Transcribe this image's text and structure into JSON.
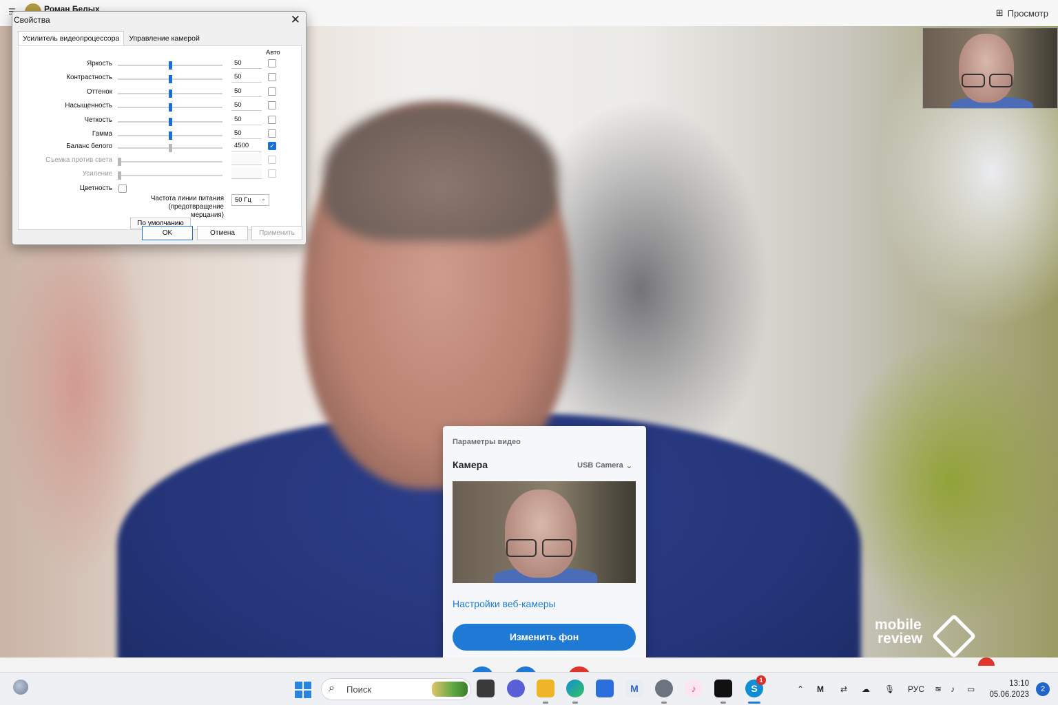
{
  "topbar": {
    "caller_name": "Роман Белых",
    "view_label": "Просмотр"
  },
  "dialog": {
    "title": "Свойства",
    "tabs": [
      "Усилитель видеопроцессора",
      "Управление камерой"
    ],
    "auto_label": "Авто",
    "properties": [
      {
        "label": "Яркость",
        "value": "50",
        "level": 0.5,
        "auto": false,
        "enabled": true
      },
      {
        "label": "Контрастность",
        "value": "50",
        "level": 0.5,
        "auto": false,
        "enabled": true
      },
      {
        "label": "Оттенок",
        "value": "50",
        "level": 0.5,
        "auto": false,
        "enabled": true
      },
      {
        "label": "Насыщенность",
        "value": "50",
        "level": 0.5,
        "auto": false,
        "enabled": true
      },
      {
        "label": "Четкость",
        "value": "50",
        "level": 0.5,
        "auto": false,
        "enabled": true
      },
      {
        "label": "Гамма",
        "value": "50",
        "level": 0.5,
        "auto": false,
        "enabled": true
      },
      {
        "label": "Баланс белого",
        "value": "4500",
        "level": 0.5,
        "auto": true,
        "enabled": true
      },
      {
        "label": "Съемка против света",
        "value": "",
        "level": 0.0,
        "auto": false,
        "enabled": false
      },
      {
        "label": "Усиление",
        "value": "",
        "level": 0.0,
        "auto": false,
        "enabled": false
      }
    ],
    "color_label": "Цветность",
    "power_line_label": "Частота линии питания (предотвращение мерцания)",
    "power_line_value": "50 Гц",
    "default_button": "По умолчанию",
    "ok_button": "OK",
    "cancel_button": "Отмена",
    "apply_button": "Применить"
  },
  "video_panel": {
    "title": "Параметры видео",
    "camera_label": "Камера",
    "camera_value": "USB Camera",
    "webcam_settings_link": "Настройки веб-камеры",
    "change_background_button": "Изменить фон"
  },
  "watermark": {
    "line1": "mobile",
    "line2": "review"
  },
  "taskbar": {
    "search_label": "Поиск",
    "language": "РУС",
    "time": "13:10",
    "date": "05.06.2023",
    "notification_count": "2",
    "skype_badge": "1"
  },
  "colors": {
    "accent": "#1e7ad4",
    "slider_thumb": "#1a6fd6",
    "shirt": "#25357a"
  }
}
